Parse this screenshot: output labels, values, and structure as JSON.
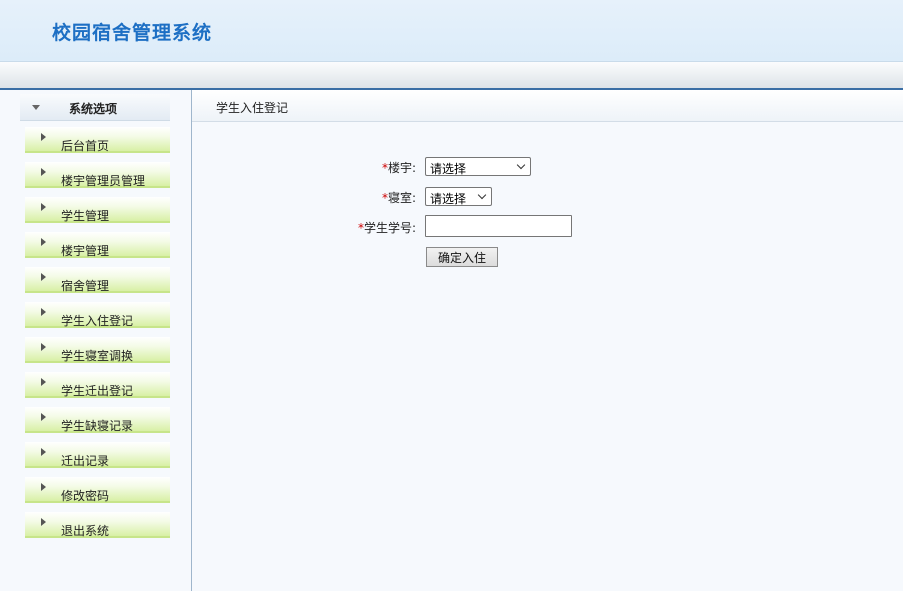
{
  "header": {
    "title": "校园宿舍管理系统"
  },
  "sidebar": {
    "heading": "系统选项",
    "items": [
      {
        "label": "后台首页"
      },
      {
        "label": "楼宇管理员管理"
      },
      {
        "label": "学生管理"
      },
      {
        "label": "楼宇管理"
      },
      {
        "label": "宿舍管理"
      },
      {
        "label": "学生入住登记"
      },
      {
        "label": "学生寝室调换"
      },
      {
        "label": "学生迁出登记"
      },
      {
        "label": "学生缺寝记录"
      },
      {
        "label": "迁出记录"
      },
      {
        "label": "修改密码"
      },
      {
        "label": "退出系统"
      }
    ]
  },
  "main": {
    "breadcrumb": "学生入住登记",
    "form": {
      "required_mark": "*",
      "building_label": "楼宇:",
      "building_value": "请选择",
      "room_label": "寝室:",
      "room_value": "请选择",
      "student_id_label": "学生学号:",
      "student_id_value": "",
      "submit_label": "确定入住"
    }
  },
  "colors": {
    "title": "#1d6fc4",
    "menu_gradient_end": "#d8f0a6",
    "topbar_border": "#3a6ea5",
    "required": "#cc0000"
  }
}
